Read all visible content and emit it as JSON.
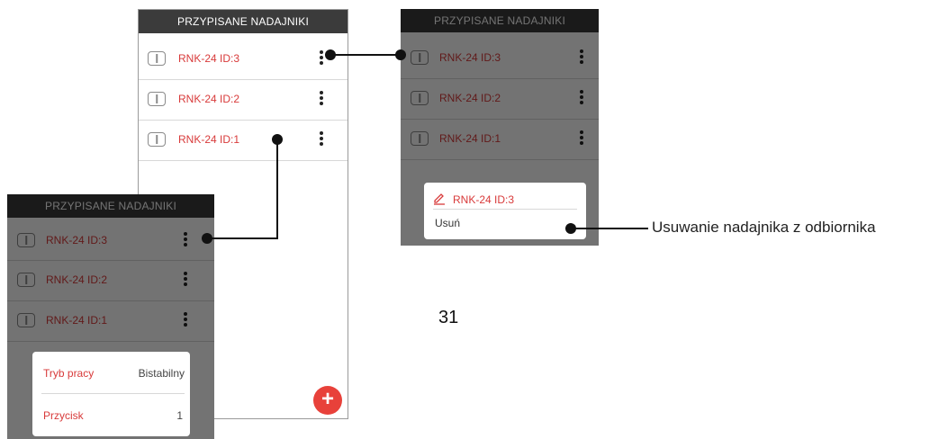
{
  "screen_title": "PRZYPISANE NADAJNIKI",
  "transmitters": [
    "RNK-24 ID:3",
    "RNK-24 ID:2",
    "RNK-24 ID:1"
  ],
  "icons": {
    "device": "two-button-remote-icon",
    "menu": "kebab-menu-icon",
    "add": "plus-icon",
    "edit": "pencil-icon"
  },
  "rename_popup": {
    "name": "RNK-24 ID:3",
    "delete_label": "Usuń"
  },
  "settings_popup": {
    "mode_label": "Tryb pracy",
    "mode_value": "Bistabilny",
    "button_label": "Przycisk",
    "button_value": "1"
  },
  "fab_symbol": "+",
  "callout": "Usuwanie nadajnika z odbiornika",
  "page_number": "31",
  "colors": {
    "accent_red": "#d83a3a",
    "title_bar": "#3b3b3b",
    "fab": "#e8413a"
  }
}
